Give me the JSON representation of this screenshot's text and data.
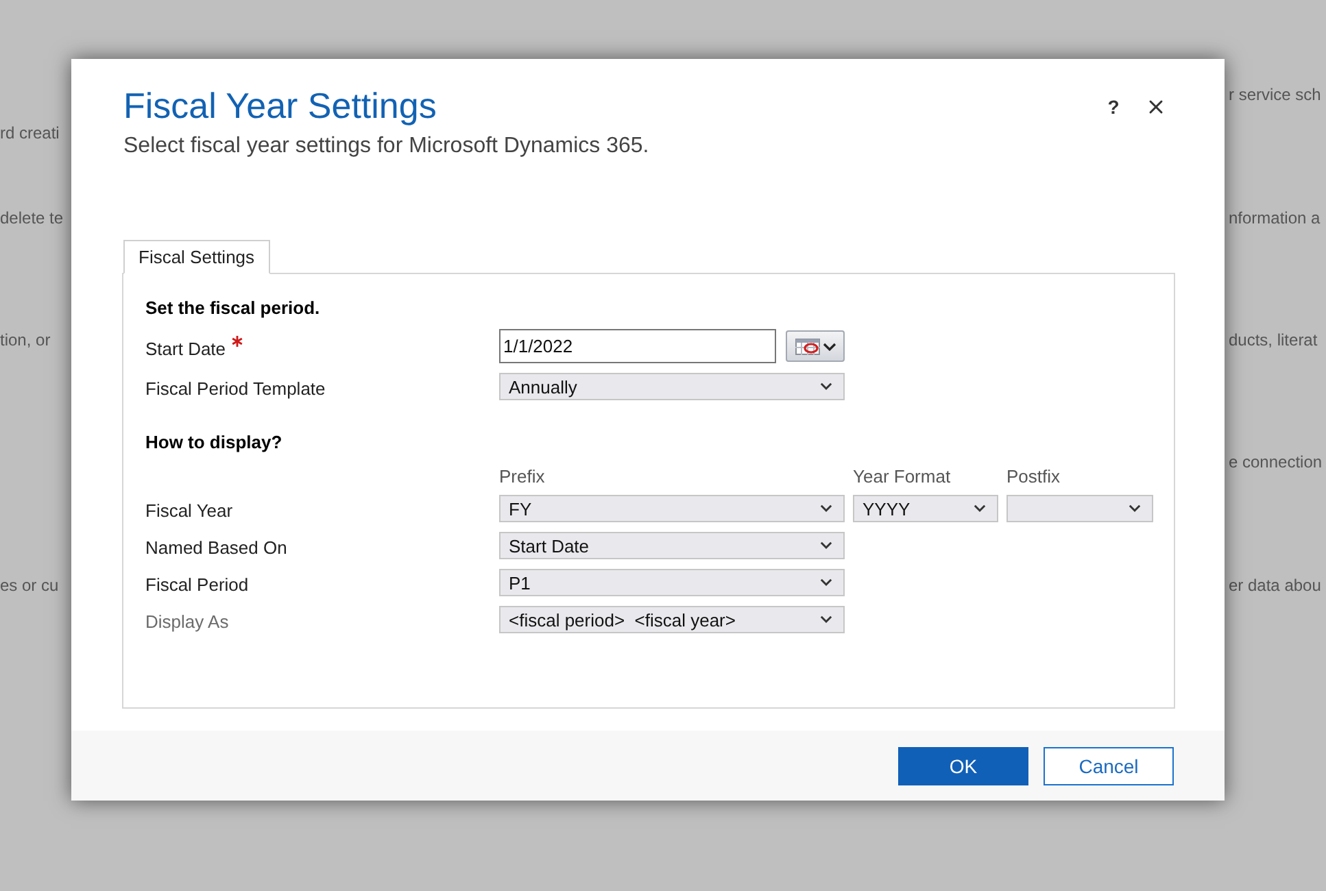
{
  "background": {
    "left_texts": [
      "rd creati",
      "delete te",
      "tion, or",
      "es or cu"
    ],
    "right_texts": [
      "r service sch",
      "nformation a",
      "ducts, literat",
      "e connection",
      "er data abou"
    ]
  },
  "dialog": {
    "title": "Fiscal Year Settings",
    "subtitle": "Select fiscal year settings for Microsoft Dynamics 365.",
    "help_button": {
      "label": "?"
    }
  },
  "tabs": [
    {
      "label": "Fiscal Settings",
      "selected": true
    }
  ],
  "sections": [
    {
      "heading": "Set the fiscal period.",
      "rows": [
        {
          "label": "Start Date",
          "required": true,
          "disabled": false,
          "fields": [
            {
              "kind": "date",
              "value": "1/1/2022"
            }
          ]
        },
        {
          "label": "Fiscal Period Template",
          "required": false,
          "disabled": false,
          "fields": [
            {
              "kind": "select",
              "value": "Annually"
            }
          ]
        }
      ]
    },
    {
      "heading": "How to display?",
      "column_labels": [
        "Prefix",
        "Year Format",
        "Postfix"
      ],
      "rows": [
        {
          "label": "Fiscal Year",
          "required": false,
          "disabled": false,
          "fields": [
            {
              "kind": "select",
              "value": "FY"
            },
            {
              "kind": "select",
              "value": "YYYY"
            },
            {
              "kind": "select"
            }
          ]
        },
        {
          "label": "Named Based On",
          "required": false,
          "disabled": false,
          "fields": [
            {
              "kind": "select",
              "value": "Start Date"
            }
          ]
        },
        {
          "label": "Fiscal Period",
          "required": false,
          "disabled": false,
          "fields": [
            {
              "kind": "select",
              "value": "P1"
            }
          ]
        },
        {
          "label": "Display As",
          "required": false,
          "disabled": true,
          "fields": [
            {
              "kind": "select",
              "value": "<fiscal period>  <fiscal year>"
            }
          ]
        }
      ]
    }
  ],
  "buttons": [
    {
      "label": "OK",
      "kind": "primary"
    },
    {
      "label": "Cancel",
      "kind": "secondary"
    }
  ]
}
